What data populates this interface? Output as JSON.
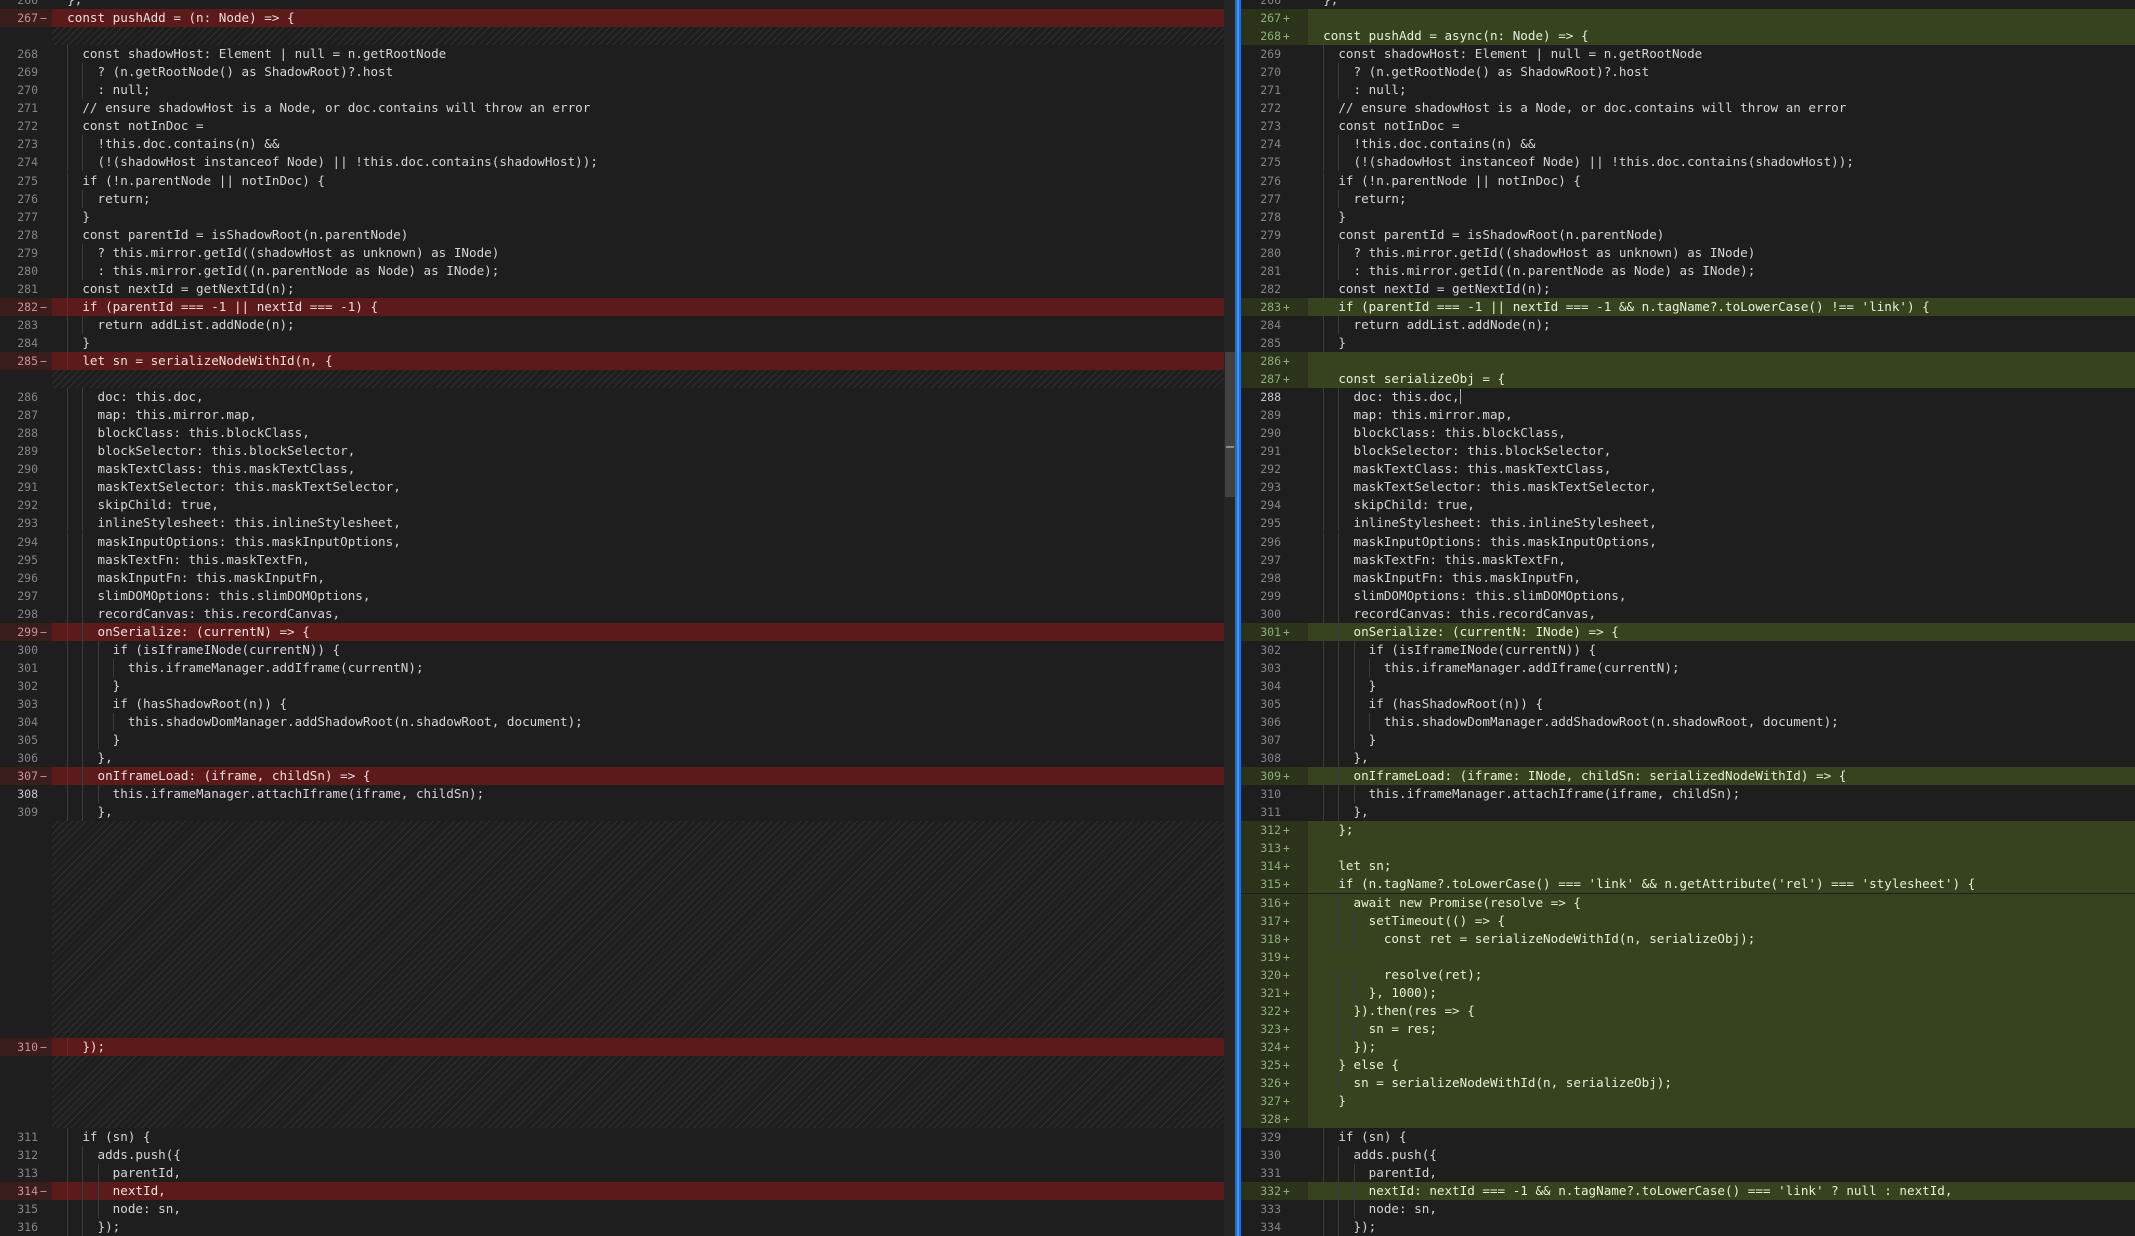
{
  "left": {
    "lines": [
      {
        "n": "266",
        "t": "  };",
        "k": "ctx"
      },
      {
        "n": "267",
        "t": "  const pushAdd = (n: Node) => {",
        "k": "del"
      },
      {
        "n": "",
        "t": "",
        "k": "hatch",
        "h": 1
      },
      {
        "n": "268",
        "t": "    const shadowHost: Element | null = n.getRootNode",
        "k": "ctx"
      },
      {
        "n": "269",
        "t": "      ? (n.getRootNode() as ShadowRoot)?.host",
        "k": "ctx"
      },
      {
        "n": "270",
        "t": "      : null;",
        "k": "ctx"
      },
      {
        "n": "271",
        "t": "    // ensure shadowHost is a Node, or doc.contains will throw an error",
        "k": "ctx"
      },
      {
        "n": "272",
        "t": "    const notInDoc =",
        "k": "ctx"
      },
      {
        "n": "273",
        "t": "      !this.doc.contains(n) &&",
        "k": "ctx"
      },
      {
        "n": "274",
        "t": "      (!(shadowHost instanceof Node) || !this.doc.contains(shadowHost));",
        "k": "ctx"
      },
      {
        "n": "275",
        "t": "    if (!n.parentNode || notInDoc) {",
        "k": "ctx"
      },
      {
        "n": "276",
        "t": "      return;",
        "k": "ctx"
      },
      {
        "n": "277",
        "t": "    }",
        "k": "ctx"
      },
      {
        "n": "278",
        "t": "    const parentId = isShadowRoot(n.parentNode)",
        "k": "ctx"
      },
      {
        "n": "279",
        "t": "      ? this.mirror.getId((shadowHost as unknown) as INode)",
        "k": "ctx"
      },
      {
        "n": "280",
        "t": "      : this.mirror.getId((n.parentNode as Node) as INode);",
        "k": "ctx"
      },
      {
        "n": "281",
        "t": "    const nextId = getNextId(n);",
        "k": "ctx"
      },
      {
        "n": "282",
        "t": "    if (parentId === -1 || nextId === -1) {",
        "k": "del"
      },
      {
        "n": "283",
        "t": "      return addList.addNode(n);",
        "k": "ctx"
      },
      {
        "n": "284",
        "t": "    }",
        "k": "ctx"
      },
      {
        "n": "285",
        "t": "    let sn = serializeNodeWithId(n, {",
        "k": "del"
      },
      {
        "n": "",
        "t": "",
        "k": "hatch",
        "h": 1
      },
      {
        "n": "286",
        "t": "      doc: this.doc,",
        "k": "ctx"
      },
      {
        "n": "287",
        "t": "      map: this.mirror.map,",
        "k": "ctx"
      },
      {
        "n": "288",
        "t": "      blockClass: this.blockClass,",
        "k": "ctx"
      },
      {
        "n": "289",
        "t": "      blockSelector: this.blockSelector,",
        "k": "ctx"
      },
      {
        "n": "290",
        "t": "      maskTextClass: this.maskTextClass,",
        "k": "ctx"
      },
      {
        "n": "291",
        "t": "      maskTextSelector: this.maskTextSelector,",
        "k": "ctx"
      },
      {
        "n": "292",
        "t": "      skipChild: true,",
        "k": "ctx"
      },
      {
        "n": "293",
        "t": "      inlineStylesheet: this.inlineStylesheet,",
        "k": "ctx"
      },
      {
        "n": "294",
        "t": "      maskInputOptions: this.maskInputOptions,",
        "k": "ctx"
      },
      {
        "n": "295",
        "t": "      maskTextFn: this.maskTextFn,",
        "k": "ctx"
      },
      {
        "n": "296",
        "t": "      maskInputFn: this.maskInputFn,",
        "k": "ctx"
      },
      {
        "n": "297",
        "t": "      slimDOMOptions: this.slimDOMOptions,",
        "k": "ctx"
      },
      {
        "n": "298",
        "t": "      recordCanvas: this.recordCanvas,",
        "k": "ctx"
      },
      {
        "n": "299",
        "t": "      onSerialize: (currentN) => {",
        "k": "del"
      },
      {
        "n": "300",
        "t": "        if (isIframeINode(currentN)) {",
        "k": "ctx"
      },
      {
        "n": "301",
        "t": "          this.iframeManager.addIframe(currentN);",
        "k": "ctx"
      },
      {
        "n": "302",
        "t": "        }",
        "k": "ctx"
      },
      {
        "n": "303",
        "t": "        if (hasShadowRoot(n)) {",
        "k": "ctx"
      },
      {
        "n": "304",
        "t": "          this.shadowDomManager.addShadowRoot(n.shadowRoot, document);",
        "k": "ctx"
      },
      {
        "n": "305",
        "t": "        }",
        "k": "ctx"
      },
      {
        "n": "306",
        "t": "      },",
        "k": "ctx"
      },
      {
        "n": "307",
        "t": "      onIframeLoad: (iframe, childSn) => {",
        "k": "del"
      },
      {
        "n": "308",
        "t": "        this.iframeManager.attachIframe(iframe, childSn);",
        "k": "ctx",
        "active": true
      },
      {
        "n": "309",
        "t": "      },",
        "k": "ctx"
      },
      {
        "n": "",
        "t": "",
        "k": "hatch",
        "h": 12
      },
      {
        "n": "310",
        "t": "    });",
        "k": "del"
      },
      {
        "n": "",
        "t": "",
        "k": "hatch",
        "h": 4
      },
      {
        "n": "311",
        "t": "    if (sn) {",
        "k": "ctx"
      },
      {
        "n": "312",
        "t": "      adds.push({",
        "k": "ctx"
      },
      {
        "n": "313",
        "t": "        parentId,",
        "k": "ctx"
      },
      {
        "n": "314",
        "t": "        nextId,",
        "k": "del"
      },
      {
        "n": "315",
        "t": "        node: sn,",
        "k": "ctx"
      },
      {
        "n": "316",
        "t": "      });",
        "k": "ctx"
      }
    ]
  },
  "right": {
    "lines": [
      {
        "n": "266",
        "t": "  };",
        "k": "ctx"
      },
      {
        "n": "267",
        "t": "",
        "k": "add"
      },
      {
        "n": "268",
        "t": "  const pushAdd = async(n: Node) => {",
        "k": "add"
      },
      {
        "n": "269",
        "t": "    const shadowHost: Element | null = n.getRootNode",
        "k": "ctx"
      },
      {
        "n": "270",
        "t": "      ? (n.getRootNode() as ShadowRoot)?.host",
        "k": "ctx"
      },
      {
        "n": "271",
        "t": "      : null;",
        "k": "ctx"
      },
      {
        "n": "272",
        "t": "    // ensure shadowHost is a Node, or doc.contains will throw an error",
        "k": "ctx"
      },
      {
        "n": "273",
        "t": "    const notInDoc =",
        "k": "ctx"
      },
      {
        "n": "274",
        "t": "      !this.doc.contains(n) &&",
        "k": "ctx"
      },
      {
        "n": "275",
        "t": "      (!(shadowHost instanceof Node) || !this.doc.contains(shadowHost));",
        "k": "ctx"
      },
      {
        "n": "276",
        "t": "    if (!n.parentNode || notInDoc) {",
        "k": "ctx"
      },
      {
        "n": "277",
        "t": "      return;",
        "k": "ctx"
      },
      {
        "n": "278",
        "t": "    }",
        "k": "ctx"
      },
      {
        "n": "279",
        "t": "    const parentId = isShadowRoot(n.parentNode)",
        "k": "ctx"
      },
      {
        "n": "280",
        "t": "      ? this.mirror.getId((shadowHost as unknown) as INode)",
        "k": "ctx"
      },
      {
        "n": "281",
        "t": "      : this.mirror.getId((n.parentNode as Node) as INode);",
        "k": "ctx"
      },
      {
        "n": "282",
        "t": "    const nextId = getNextId(n);",
        "k": "ctx"
      },
      {
        "n": "283",
        "t": "    if (parentId === -1 || nextId === -1 && n.tagName?.toLowerCase() !== 'link') {",
        "k": "add"
      },
      {
        "n": "284",
        "t": "      return addList.addNode(n);",
        "k": "ctx"
      },
      {
        "n": "285",
        "t": "    }",
        "k": "ctx"
      },
      {
        "n": "286",
        "t": "",
        "k": "add"
      },
      {
        "n": "287",
        "t": "    const serializeObj = {",
        "k": "add"
      },
      {
        "n": "288",
        "t": "      doc: this.doc,",
        "k": "ctx",
        "active": true,
        "cursor": true
      },
      {
        "n": "289",
        "t": "      map: this.mirror.map,",
        "k": "ctx"
      },
      {
        "n": "290",
        "t": "      blockClass: this.blockClass,",
        "k": "ctx"
      },
      {
        "n": "291",
        "t": "      blockSelector: this.blockSelector,",
        "k": "ctx"
      },
      {
        "n": "292",
        "t": "      maskTextClass: this.maskTextClass,",
        "k": "ctx"
      },
      {
        "n": "293",
        "t": "      maskTextSelector: this.maskTextSelector,",
        "k": "ctx"
      },
      {
        "n": "294",
        "t": "      skipChild: true,",
        "k": "ctx"
      },
      {
        "n": "295",
        "t": "      inlineStylesheet: this.inlineStylesheet,",
        "k": "ctx"
      },
      {
        "n": "296",
        "t": "      maskInputOptions: this.maskInputOptions,",
        "k": "ctx"
      },
      {
        "n": "297",
        "t": "      maskTextFn: this.maskTextFn,",
        "k": "ctx"
      },
      {
        "n": "298",
        "t": "      maskInputFn: this.maskInputFn,",
        "k": "ctx"
      },
      {
        "n": "299",
        "t": "      slimDOMOptions: this.slimDOMOptions,",
        "k": "ctx"
      },
      {
        "n": "300",
        "t": "      recordCanvas: this.recordCanvas,",
        "k": "ctx"
      },
      {
        "n": "301",
        "t": "      onSerialize: (currentN: INode) => {",
        "k": "add"
      },
      {
        "n": "302",
        "t": "        if (isIframeINode(currentN)) {",
        "k": "ctx"
      },
      {
        "n": "303",
        "t": "          this.iframeManager.addIframe(currentN);",
        "k": "ctx"
      },
      {
        "n": "304",
        "t": "        }",
        "k": "ctx"
      },
      {
        "n": "305",
        "t": "        if (hasShadowRoot(n)) {",
        "k": "ctx"
      },
      {
        "n": "306",
        "t": "          this.shadowDomManager.addShadowRoot(n.shadowRoot, document);",
        "k": "ctx"
      },
      {
        "n": "307",
        "t": "        }",
        "k": "ctx"
      },
      {
        "n": "308",
        "t": "      },",
        "k": "ctx"
      },
      {
        "n": "309",
        "t": "      onIframeLoad: (iframe: INode, childSn: serializedNodeWithId) => {",
        "k": "add"
      },
      {
        "n": "310",
        "t": "        this.iframeManager.attachIframe(iframe, childSn);",
        "k": "ctx"
      },
      {
        "n": "311",
        "t": "      },",
        "k": "ctx"
      },
      {
        "n": "312",
        "t": "    };",
        "k": "add"
      },
      {
        "n": "313",
        "t": "",
        "k": "add"
      },
      {
        "n": "314",
        "t": "    let sn;",
        "k": "add"
      },
      {
        "n": "315",
        "t": "    if (n.tagName?.toLowerCase() === 'link' && n.getAttribute('rel') === 'stylesheet') {",
        "k": "add"
      },
      {
        "n": "316",
        "t": "      await new Promise(resolve => {",
        "k": "add"
      },
      {
        "n": "317",
        "t": "        setTimeout(() => {",
        "k": "add"
      },
      {
        "n": "318",
        "t": "          const ret = serializeNodeWithId(n, serializeObj);",
        "k": "add"
      },
      {
        "n": "319",
        "t": "",
        "k": "add"
      },
      {
        "n": "320",
        "t": "          resolve(ret);",
        "k": "add"
      },
      {
        "n": "321",
        "t": "        }, 1000);",
        "k": "add"
      },
      {
        "n": "322",
        "t": "      }).then(res => {",
        "k": "add"
      },
      {
        "n": "323",
        "t": "        sn = res;",
        "k": "add"
      },
      {
        "n": "324",
        "t": "      });",
        "k": "add"
      },
      {
        "n": "325",
        "t": "    } else {",
        "k": "add"
      },
      {
        "n": "326",
        "t": "      sn = serializeNodeWithId(n, serializeObj);",
        "k": "add"
      },
      {
        "n": "327",
        "t": "    }",
        "k": "add"
      },
      {
        "n": "328",
        "t": "",
        "k": "add"
      },
      {
        "n": "329",
        "t": "    if (sn) {",
        "k": "ctx"
      },
      {
        "n": "330",
        "t": "      adds.push({",
        "k": "ctx"
      },
      {
        "n": "331",
        "t": "        parentId,",
        "k": "ctx"
      },
      {
        "n": "332",
        "t": "        nextId: nextId === -1 && n.tagName?.toLowerCase() === 'link' ? null : nextId,",
        "k": "add"
      },
      {
        "n": "333",
        "t": "        node: sn,",
        "k": "ctx"
      },
      {
        "n": "334",
        "t": "      });",
        "k": "ctx"
      }
    ]
  },
  "markers": {
    "del": "−",
    "add": "+"
  },
  "colors": {
    "background": "#1e1e1e",
    "removed_line": "#5c1a1a",
    "inserted_line": "#37431f",
    "sash": "#1f6fd1"
  }
}
